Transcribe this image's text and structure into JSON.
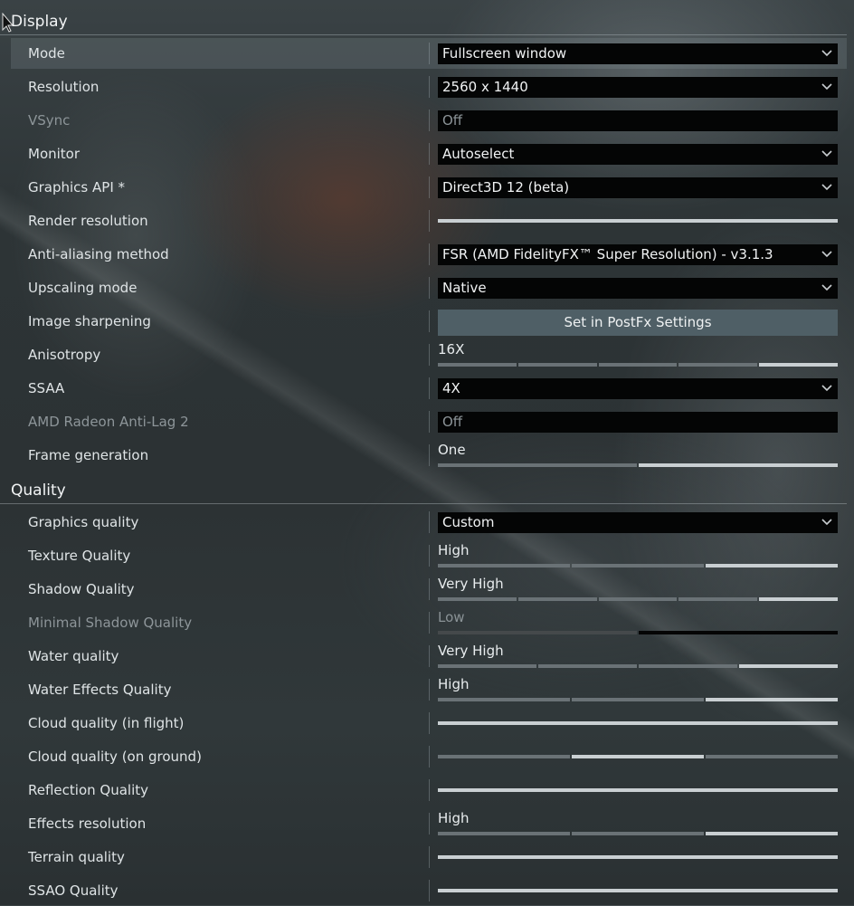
{
  "sections": [
    {
      "title": "Display",
      "rows": [
        {
          "label": "Mode",
          "type": "dropdown",
          "value": "Fullscreen window",
          "highlight": true
        },
        {
          "label": "Resolution",
          "type": "dropdown",
          "value": "2560 x 1440"
        },
        {
          "label": "VSync",
          "type": "static",
          "value": "Off",
          "disabled": true
        },
        {
          "label": "Monitor",
          "type": "dropdown",
          "value": "Autoselect"
        },
        {
          "label": "Graphics API *",
          "type": "dropdown",
          "value": "Direct3D 12 (beta)"
        },
        {
          "label": "Render resolution",
          "type": "slider",
          "value": "",
          "steps": 1,
          "level": 1
        },
        {
          "label": "Anti-aliasing method",
          "type": "dropdown",
          "value": "FSR (AMD FidelityFX™ Super Resolution) - v3.1.3"
        },
        {
          "label": "Upscaling mode",
          "type": "dropdown",
          "value": "Native"
        },
        {
          "label": "Image sharpening",
          "type": "button",
          "value": "Set in PostFx Settings"
        },
        {
          "label": "Anisotropy",
          "type": "slider",
          "value": "16X",
          "steps": 5,
          "level": 5
        },
        {
          "label": "SSAA",
          "type": "dropdown",
          "value": "4X"
        },
        {
          "label": "AMD Radeon Anti-Lag 2",
          "type": "static",
          "value": "Off",
          "disabled": true
        },
        {
          "label": "Frame generation",
          "type": "slider",
          "value": "One",
          "steps": 2,
          "level": 2
        }
      ]
    },
    {
      "title": "Quality",
      "rows": [
        {
          "label": "Graphics quality",
          "type": "dropdown",
          "value": "Custom"
        },
        {
          "label": "Texture Quality",
          "type": "slider",
          "value": "High",
          "steps": 3,
          "level": 3
        },
        {
          "label": "Shadow Quality",
          "type": "slider",
          "value": "Very High",
          "steps": 5,
          "level": 5
        },
        {
          "label": "Minimal Shadow Quality",
          "type": "slider",
          "value": "Low",
          "steps": 2,
          "level": 1,
          "disabled": true
        },
        {
          "label": "Water quality",
          "type": "slider",
          "value": "Very High",
          "steps": 4,
          "level": 4
        },
        {
          "label": "Water Effects Quality",
          "type": "slider",
          "value": "High",
          "steps": 3,
          "level": 3
        },
        {
          "label": "Cloud quality (in flight)",
          "type": "slider",
          "value": "",
          "steps": 1,
          "level": 1
        },
        {
          "label": "Cloud quality (on ground)",
          "type": "slider",
          "value": "",
          "steps": 3,
          "level": 2
        },
        {
          "label": "Reflection Quality",
          "type": "slider",
          "value": "",
          "steps": 1,
          "level": 1
        },
        {
          "label": "Effects resolution",
          "type": "slider",
          "value": "High",
          "steps": 3,
          "level": 3
        },
        {
          "label": "Terrain quality",
          "type": "slider",
          "value": "",
          "steps": 1,
          "level": 1
        },
        {
          "label": "SSAO Quality",
          "type": "slider",
          "value": "",
          "steps": 1,
          "level": 1
        }
      ]
    }
  ],
  "colors": {
    "slider_active": "#c9cfd2",
    "slider_inactive": "#6a7276",
    "slider_disabled_active": "#45494b",
    "slider_disabled_inactive": "#050505",
    "dropdown_bg": "#040505",
    "button_bg": "#4f5f66"
  },
  "icons": {
    "dropdown": "chevron-down-icon",
    "cursor": "mouse-cursor-icon"
  }
}
